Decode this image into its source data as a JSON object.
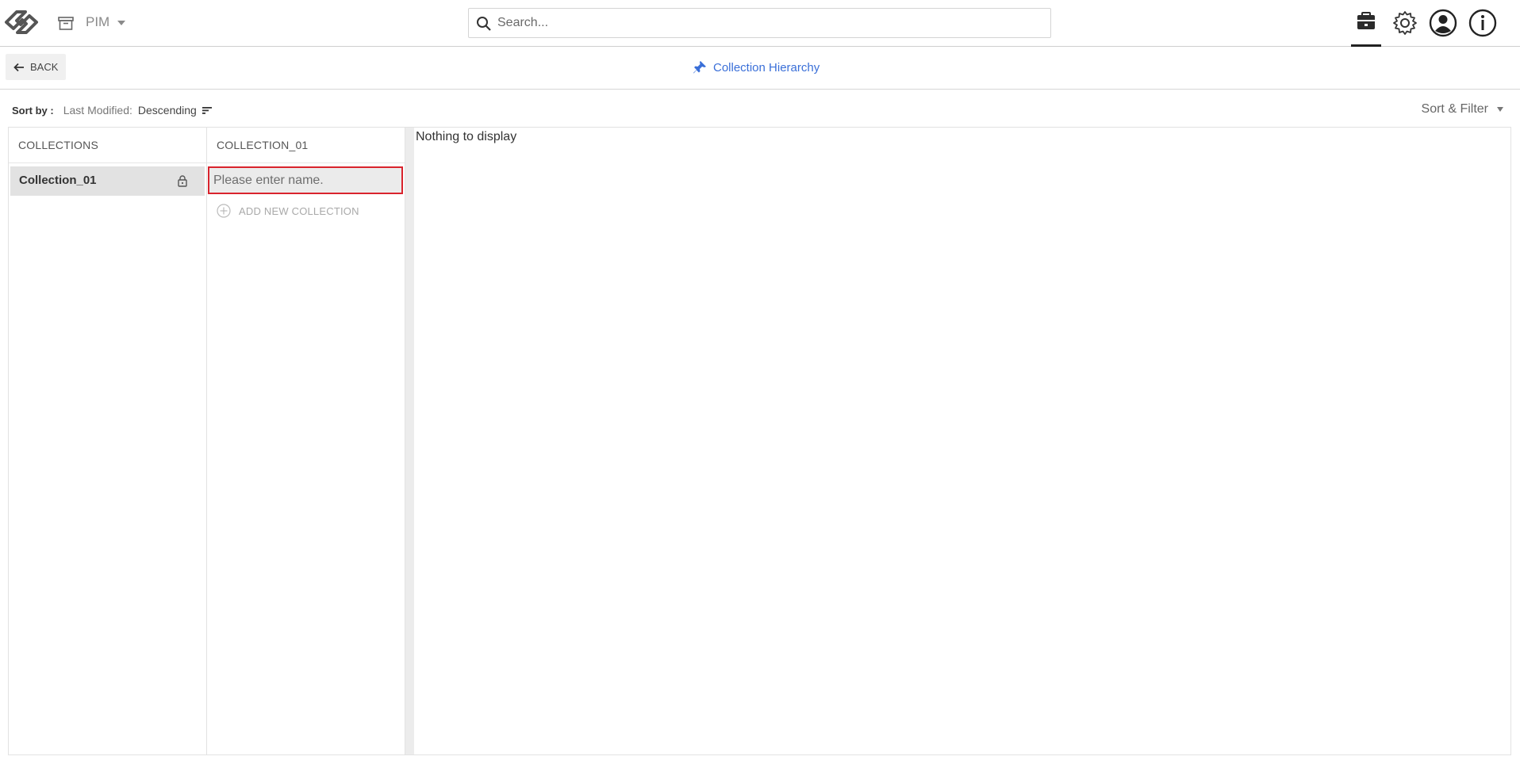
{
  "header": {
    "module_label": "PIM",
    "search_placeholder": "Search...",
    "icons": [
      "logo-icon",
      "archive-icon",
      "chevron-down-icon",
      "search-icon",
      "briefcase-icon",
      "gear-icon",
      "user-icon",
      "info-icon"
    ]
  },
  "subheader": {
    "back_label": "BACK",
    "title": "Collection Hierarchy"
  },
  "sort": {
    "label": "Sort by :",
    "field": "Last Modified:",
    "direction": "Descending",
    "filter_label": "Sort & Filter"
  },
  "columns": [
    {
      "header": "COLLECTIONS",
      "items": [
        {
          "label": "Collection_01",
          "locked": true,
          "selected": true
        }
      ]
    },
    {
      "header": "COLLECTION_01",
      "input_placeholder": "Please enter name.",
      "add_label": "ADD NEW COLLECTION"
    }
  ],
  "detail": {
    "empty_message": "Nothing to display"
  },
  "colors": {
    "accent": "#3a6fd8",
    "error_border": "#d9232d",
    "selected_bg": "#e2e2e2"
  }
}
